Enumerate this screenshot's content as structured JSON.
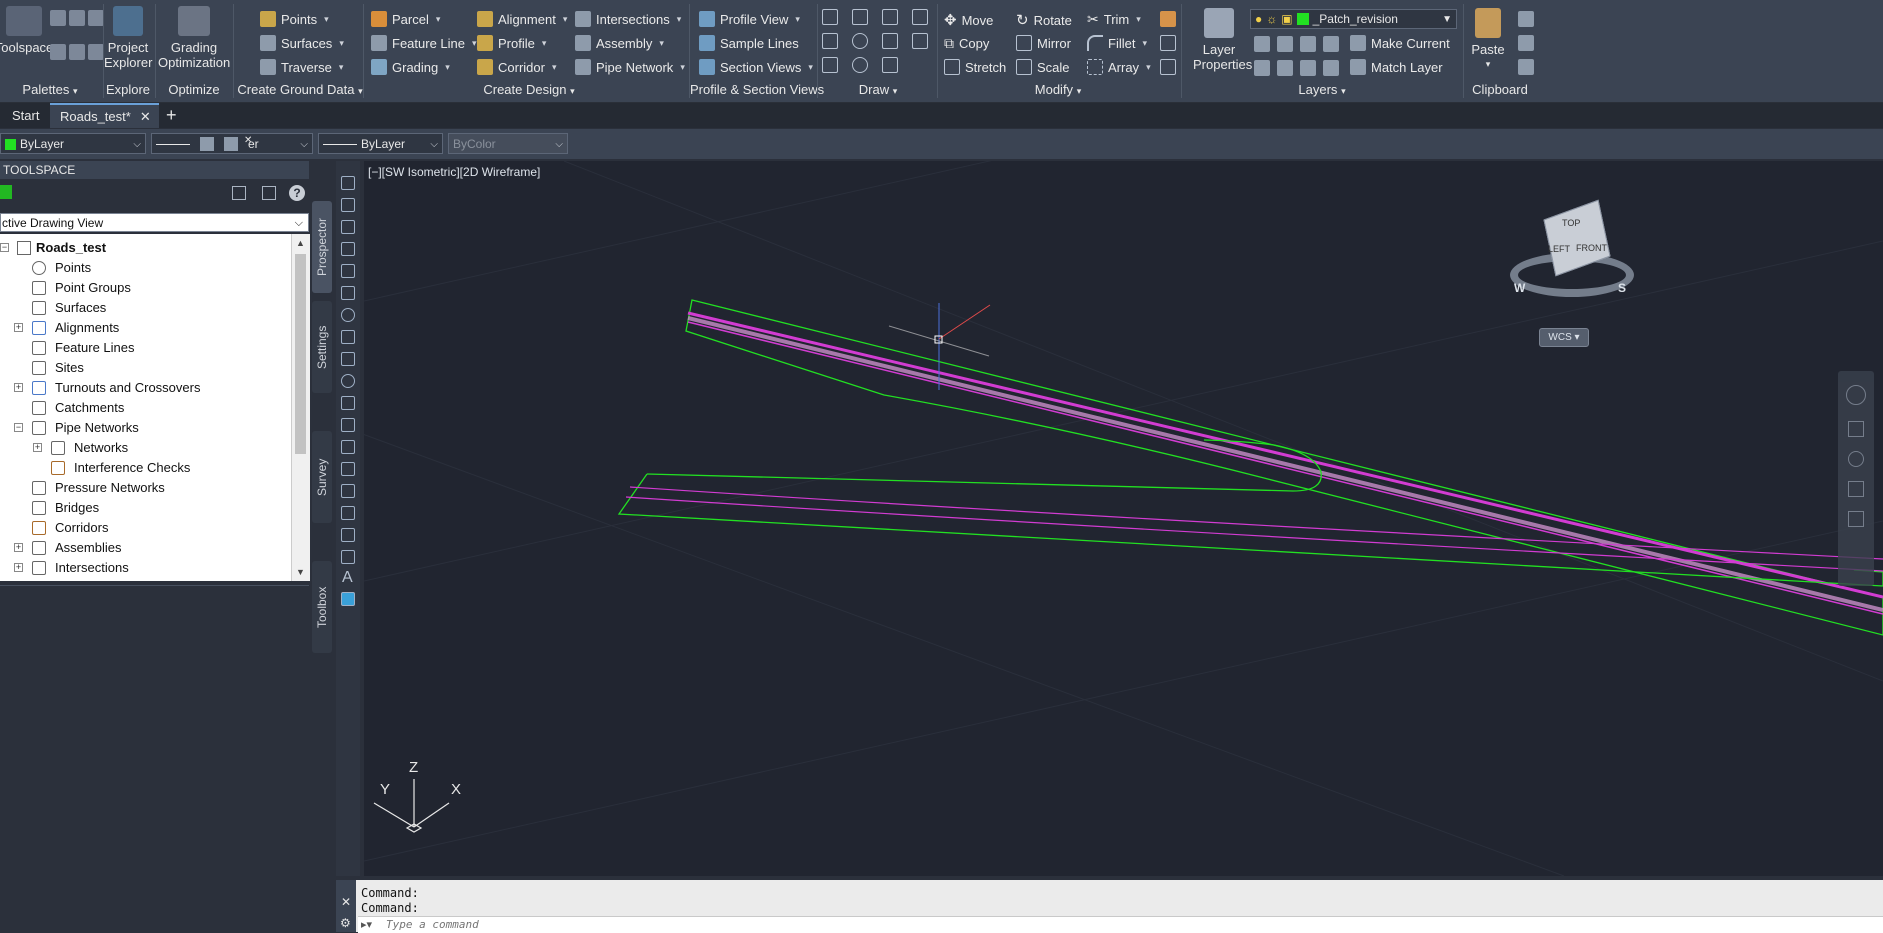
{
  "ribbon": {
    "palettes": {
      "toolspace": "Toolspace",
      "panel": "Palettes"
    },
    "explore": {
      "project_explorer": "Project Explorer",
      "panel": "Explore"
    },
    "optimize": {
      "grading_optimization": "Grading Optimization",
      "panel": "Optimize"
    },
    "create_ground_data": {
      "items": [
        "Points",
        "Surfaces",
        "Traverse"
      ],
      "panel": "Create Ground Data"
    },
    "create_design": {
      "col1": [
        "Parcel",
        "Feature Line",
        "Grading"
      ],
      "col2": [
        "Alignment",
        "Profile",
        "Corridor"
      ],
      "col3": [
        "Intersections",
        "Assembly",
        "Pipe Network"
      ],
      "panel": "Create Design"
    },
    "profile_section": {
      "items": [
        "Profile View",
        "Sample Lines",
        "Section Views"
      ],
      "panel": "Profile & Section Views"
    },
    "draw": {
      "panel": "Draw"
    },
    "modify": {
      "col1": [
        "Move",
        "Copy",
        "Stretch"
      ],
      "col2": [
        "Rotate",
        "Mirror",
        "Scale"
      ],
      "col3": [
        "Trim",
        "Fillet",
        "Array"
      ],
      "panel": "Modify"
    },
    "layers": {
      "layer_properties": "Layer Properties",
      "current_layer": "_Patch_revision",
      "make_current": "Make Current",
      "match_layer": "Match Layer",
      "panel": "Layers"
    },
    "clipboard": {
      "paste": "Paste",
      "panel": "Clipboard"
    }
  },
  "tabs": [
    {
      "label": "Start"
    },
    {
      "label": "Roads_test*"
    }
  ],
  "properties_bar": {
    "color": "ByLayer",
    "layer_fragment": "er",
    "linetype": "ByLayer",
    "plotstyle": "ByColor"
  },
  "toolspace": {
    "title": "TOOLSPACE",
    "view_selector": "ctive Drawing View",
    "tree": [
      "Roads_test",
      "Points",
      "Point Groups",
      "Surfaces",
      "Alignments",
      "Feature Lines",
      "Sites",
      "Turnouts and Crossovers",
      "Catchments",
      "Pipe Networks",
      "Networks",
      "Interference Checks",
      "Pressure Networks",
      "Bridges",
      "Corridors",
      "Assemblies",
      "Intersections"
    ],
    "side_tabs": [
      "Prospector",
      "Settings",
      "Survey",
      "Toolbox"
    ]
  },
  "viewport": {
    "label": "[−][SW Isometric][2D Wireframe]",
    "viewcube": {
      "top": "TOP",
      "left": "LEFT",
      "front": "FRONT",
      "w": "W",
      "s": "S",
      "wcs": "WCS"
    },
    "ucs": {
      "x": "X",
      "y": "Y",
      "z": "Z"
    }
  },
  "command": {
    "line1": "Command:",
    "line2": "Command:",
    "placeholder": "Type a command"
  },
  "colors": {
    "green": "#22e022",
    "magenta": "#d23cd2",
    "ribbon": "#3b4453",
    "viewport": "#212530"
  }
}
